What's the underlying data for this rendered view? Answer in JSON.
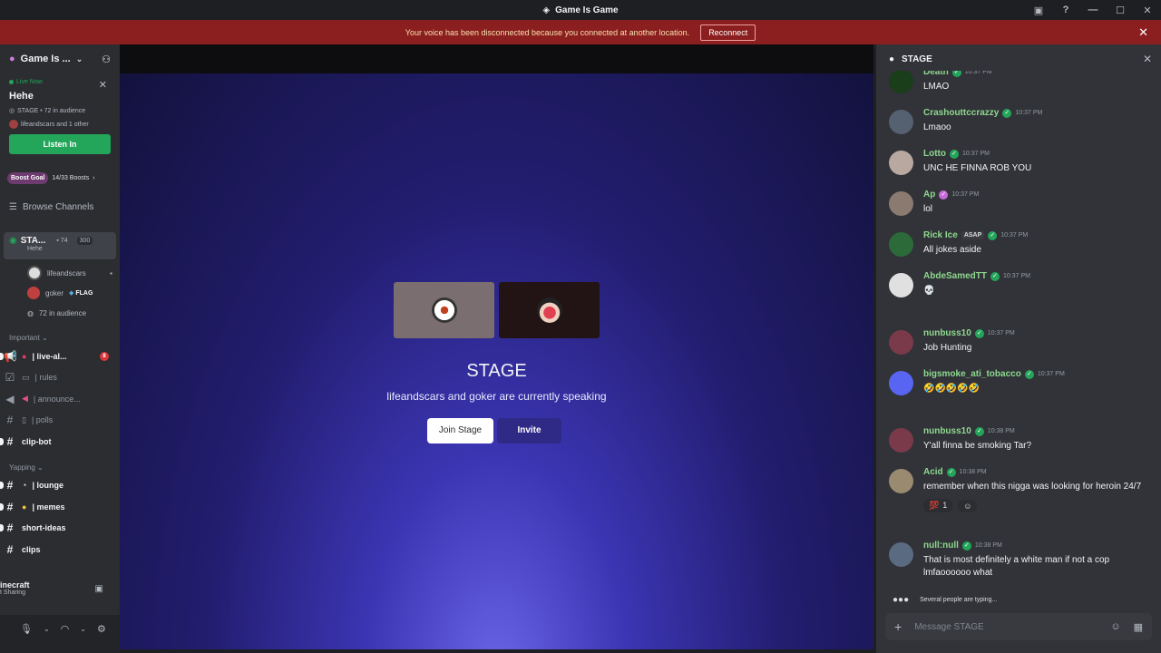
{
  "window": {
    "title": "Game Is Game"
  },
  "banner": {
    "text": "Your voice has been disconnected because you connected at another location.",
    "action": "Reconnect"
  },
  "sidebar": {
    "server_name": "Game Is ...",
    "live": {
      "status": "Live Now",
      "title": "Hehe",
      "meta": "STAGE • 72 in audience",
      "speakers": "lifeandscars and 1 other",
      "listen_button": "Listen In"
    },
    "boost": {
      "goal": "Boost Goal",
      "count": "14/33 Boosts"
    },
    "browse": "Browse Channels",
    "stage_channel": {
      "name": "STA...",
      "topic": "Hehe",
      "viewers": "74",
      "cap": "300"
    },
    "members": [
      {
        "name": "lifeandscars",
        "tag": ""
      },
      {
        "name": "goker",
        "tag": "FLAG"
      }
    ],
    "audience": "72 in audience",
    "categories": [
      {
        "name": "Important",
        "channels": [
          {
            "name": "| live-al...",
            "bold": true,
            "badge": "8",
            "icon": "📢"
          },
          {
            "name": "| rules",
            "bold": false,
            "icon": "📖"
          },
          {
            "name": "| announce...",
            "bold": false,
            "icon": "📢"
          },
          {
            "name": "| polls",
            "bold": false,
            "icon": "📄"
          },
          {
            "name": "clip-bot",
            "bold": true,
            "icon": ""
          }
        ]
      },
      {
        "name": "Yapping",
        "channels": [
          {
            "name": "| lounge",
            "bold": true,
            "icon": "💭"
          },
          {
            "name": "| memes",
            "bold": true,
            "icon": "😂"
          },
          {
            "name": "short-ideas",
            "bold": true,
            "icon": ""
          },
          {
            "name": "clips",
            "bold": true,
            "icon": ""
          }
        ]
      }
    ],
    "activity": {
      "title": "inecraft",
      "sub": "t Sharing"
    }
  },
  "stage": {
    "title": "STAGE",
    "subtitle": "lifeandscars and goker are currently speaking",
    "join_button": "Join Stage",
    "invite_button": "Invite"
  },
  "chat": {
    "title": "STAGE",
    "messages": [
      {
        "user": "Death",
        "time": "10:37 PM",
        "text": "LMAO",
        "avatar_color": "#1a3d1a",
        "verified": "green"
      },
      {
        "user": "Crashouttccrazzy",
        "time": "10:37 PM",
        "text": "Lmaoo",
        "avatar_color": "#556070",
        "verified": "green"
      },
      {
        "user": "Lotto",
        "time": "10:37 PM",
        "text": "UNC HE FINNA ROB YOU",
        "avatar_color": "#b8a8a0",
        "verified": "green"
      },
      {
        "user": "Ap",
        "time": "10:37 PM",
        "text": "lol",
        "avatar_color": "#8a7a70",
        "verified": "pink"
      },
      {
        "user": "Rick Ice",
        "tag": "ASAP",
        "time": "10:37 PM",
        "text": "All jokes aside",
        "avatar_color": "#2d6a3a",
        "verified": "green"
      },
      {
        "user": "AbdeSamedTT",
        "time": "10:37 PM",
        "text": "💀",
        "avatar_color": "#e0e0e0",
        "verified": "green"
      },
      {
        "user": "nunbuss10",
        "time": "10:37 PM",
        "text": "Job Hunting",
        "avatar_color": "#7a3a4a",
        "verified": "green"
      },
      {
        "user": "bigsmoke_ati_tobacco",
        "time": "10:37 PM",
        "text": "🤣🤣🤣🤣🤣",
        "avatar_color": "#5865f2",
        "verified": "green"
      },
      {
        "user": "nunbuss10",
        "time": "10:38 PM",
        "text": "Y'all finna be smoking Tar?",
        "avatar_color": "#7a3a4a",
        "verified": "green"
      },
      {
        "user": "Acid",
        "time": "10:38 PM",
        "text": "remember when this nigga was looking for heroin 24/7",
        "avatar_color": "#9a8a70",
        "verified": "green",
        "reaction": "💯",
        "reaction_count": "1"
      },
      {
        "user": "null:null",
        "time": "10:38 PM",
        "text": "That is most definitely a white man if not a cop lmfaoooooo what",
        "avatar_color": "#5a6a80",
        "verified": "green"
      }
    ],
    "typing": "Several people are typing...",
    "composer_placeholder": "Message STAGE"
  }
}
